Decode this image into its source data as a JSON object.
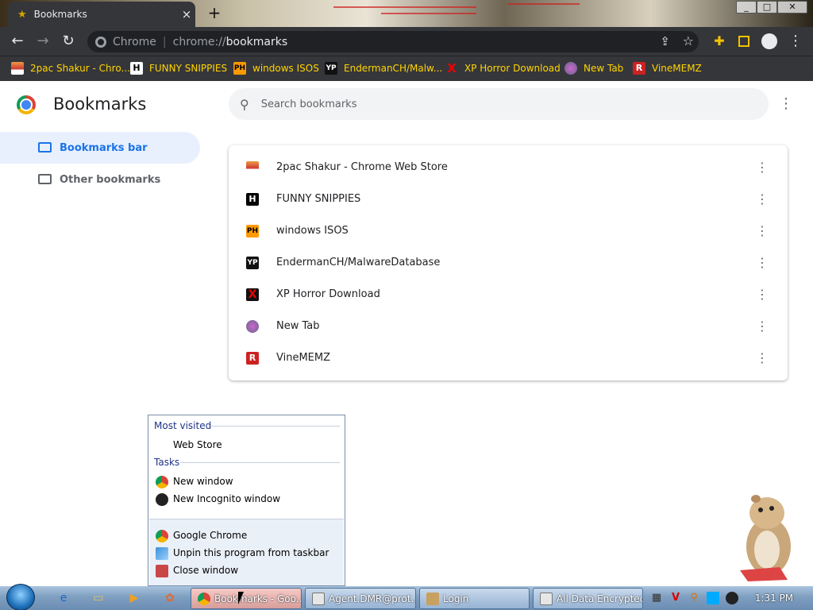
{
  "tab": {
    "title": "Bookmarks",
    "close_icon": "×",
    "new_tab": "+"
  },
  "window_buttons": {
    "minimize": "_",
    "maximize": "□",
    "close": "✕"
  },
  "omnibox": {
    "site_label": "Chrome",
    "separator": "|",
    "url_scheme": "chrome://",
    "url_path": "bookmarks"
  },
  "bookmarks_bar": [
    {
      "label": "2pac Shakur - Chro...",
      "icon": "2pac-icon"
    },
    {
      "label": "FUNNY SNIPPIES",
      "icon": "h-icon"
    },
    {
      "label": "windows ISOS",
      "icon": "ph-icon"
    },
    {
      "label": "EndermanCH/Malw...",
      "icon": "yp-icon"
    },
    {
      "label": "XP Horror Download",
      "icon": "x-icon"
    },
    {
      "label": "New Tab",
      "icon": "globe-icon"
    },
    {
      "label": "VineMEMZ",
      "icon": "r-icon"
    }
  ],
  "page": {
    "title": "Bookmarks",
    "search_placeholder": "Search bookmarks"
  },
  "sidebar": [
    {
      "label": "Bookmarks bar",
      "selected": true
    },
    {
      "label": "Other bookmarks",
      "selected": false
    }
  ],
  "bookmarks": [
    {
      "title": "2pac Shakur - Chrome Web Store",
      "icon": "2pac-icon"
    },
    {
      "title": "FUNNY SNIPPIES",
      "icon": "h-icon"
    },
    {
      "title": "windows ISOS",
      "icon": "ph-icon"
    },
    {
      "title": "EndermanCH/MalwareDatabase",
      "icon": "yp-icon"
    },
    {
      "title": "XP Horror Download",
      "icon": "x-icon"
    },
    {
      "title": "New Tab",
      "icon": "globe-icon"
    },
    {
      "title": "VineMEMZ",
      "icon": "r-icon"
    }
  ],
  "jump_list": {
    "most_visited_header": "Most visited",
    "most_visited": [
      "Web Store"
    ],
    "tasks_header": "Tasks",
    "tasks": [
      "New window",
      "New Incognito window"
    ],
    "pinned": [
      "Google Chrome",
      "Unpin this program from taskbar",
      "Close window"
    ]
  },
  "taskbar": {
    "buttons": [
      {
        "label": "Bookmarks - Goo...",
        "active": true
      },
      {
        "label": "Agent.DMR@prot...",
        "active": false
      },
      {
        "label": "Login",
        "active": false
      },
      {
        "label": "All Data Encrypted",
        "active": false
      }
    ],
    "clock": "1:31 PM"
  },
  "colors": {
    "accent": "#1a73e8",
    "bookmark_bar_text": "#ffd400",
    "toolbar_bg": "#35363a",
    "selected_bg": "#e8f0fe"
  }
}
